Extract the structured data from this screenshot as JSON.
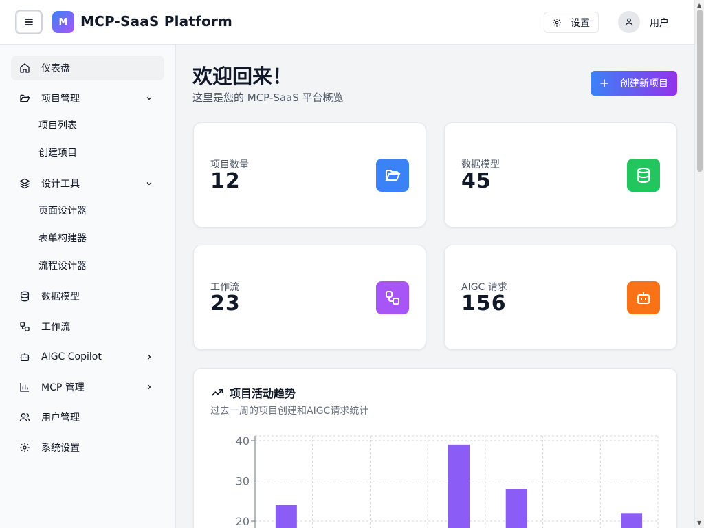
{
  "header": {
    "logo_letter": "M",
    "app_title": "MCP-SaaS Platform",
    "settings_label": "设置",
    "user_label": "用户"
  },
  "sidebar": {
    "items": [
      {
        "label": "仪表盘",
        "icon": "home-icon",
        "active": true
      },
      {
        "label": "项目管理",
        "icon": "folder-open-icon",
        "chevron": "down",
        "children": [
          "项目列表",
          "创建项目"
        ]
      },
      {
        "label": "设计工具",
        "icon": "layers-icon",
        "chevron": "down",
        "children": [
          "页面设计器",
          "表单构建器",
          "流程设计器"
        ]
      },
      {
        "label": "数据模型",
        "icon": "database-icon"
      },
      {
        "label": "工作流",
        "icon": "workflow-icon"
      },
      {
        "label": "AIGC Copilot",
        "icon": "bot-icon",
        "chevron": "right"
      },
      {
        "label": "MCP 管理",
        "icon": "bar-chart-icon",
        "chevron": "right"
      },
      {
        "label": "用户管理",
        "icon": "users-icon"
      },
      {
        "label": "系统设置",
        "icon": "gear-icon"
      }
    ]
  },
  "main": {
    "welcome_title": "欢迎回来！",
    "welcome_subtitle": "这里是您的 MCP-SaaS 平台概览",
    "create_button": "创建新项目",
    "stats": [
      {
        "label": "项目数量",
        "value": "12",
        "icon": "folder-open-icon",
        "color": "#3b82f6"
      },
      {
        "label": "数据模型",
        "value": "45",
        "icon": "database-icon",
        "color": "#22c55e"
      },
      {
        "label": "工作流",
        "value": "23",
        "icon": "workflow-icon",
        "color": "#a855f7"
      },
      {
        "label": "AIGC 请求",
        "value": "156",
        "icon": "bot-icon",
        "color": "#f97316"
      }
    ],
    "chart_card": {
      "title": "项目活动趋势",
      "subtitle": "过去一周的项目创建和AIGC请求统计"
    }
  },
  "chart_data": {
    "type": "bar",
    "title": "项目活动趋势",
    "subtitle": "过去一周的项目创建和AIGC请求统计",
    "yticks": [
      40,
      30,
      20
    ],
    "ylim_visible": [
      20,
      40
    ],
    "bar_color": "#8b5cf6",
    "grid": "dashed",
    "visible_values": [
      {
        "column": 1,
        "value": 24
      },
      {
        "column": 4,
        "value": 39
      },
      {
        "column": 5,
        "value": 28
      },
      {
        "column": 7,
        "value": 22
      }
    ]
  }
}
